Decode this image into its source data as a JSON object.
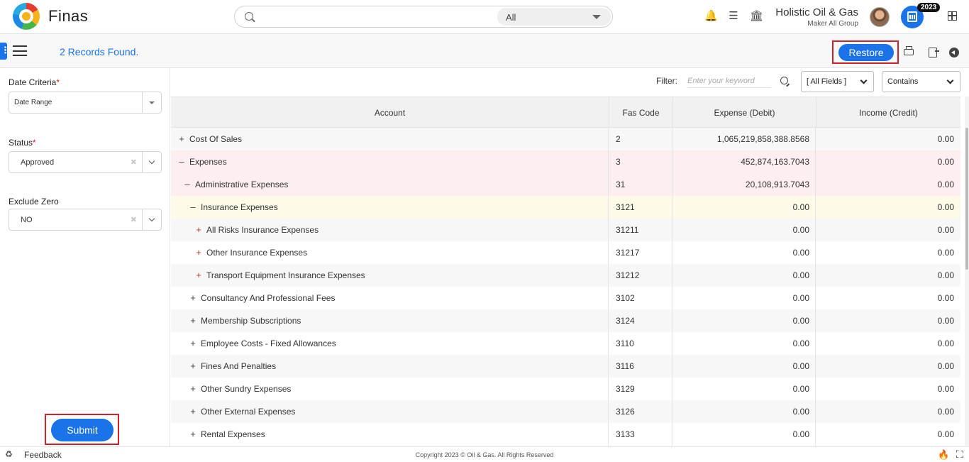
{
  "header": {
    "brand": "Finas",
    "search_placeholder": "",
    "search_scope": "All",
    "org_name": "Holistic Oil & Gas",
    "org_sub": "Maker All Group",
    "year_badge": "2023"
  },
  "toolbar": {
    "records_text": "2 Records Found.",
    "restore_label": "Restore"
  },
  "filters": {
    "date_criteria_label": "Date Criteria",
    "date_criteria_value": "Date Range",
    "status_label": "Status",
    "status_value": "Approved",
    "exclude_zero_label": "Exclude Zero",
    "exclude_zero_value": "NO",
    "submit_label": "Submit"
  },
  "filterbar": {
    "label": "Filter:",
    "placeholder": "Enter your keyword",
    "field_select": "[ All Fields ]",
    "match_select": "Contains"
  },
  "grid": {
    "columns": [
      "Account",
      "Fas Code",
      "Expense (Debit)",
      "Income (Credit)"
    ],
    "rows": [
      {
        "toggle": "+",
        "account": "Cost Of Sales",
        "fas": "2",
        "expense": "1,065,219,858,388.8568",
        "income": "0.00"
      },
      {
        "toggle": "–",
        "account": "Expenses",
        "fas": "3",
        "expense": "452,874,163.7043",
        "income": "0.00"
      },
      {
        "toggle": "–",
        "account": "Administrative Expenses",
        "fas": "31",
        "expense": "20,108,913.7043",
        "income": "0.00"
      },
      {
        "toggle": "–",
        "account": "Insurance Expenses",
        "fas": "3121",
        "expense": "0.00",
        "income": "0.00"
      },
      {
        "toggle": "+",
        "account": "All Risks Insurance Expenses",
        "fas": "31211",
        "expense": "0.00",
        "income": "0.00"
      },
      {
        "toggle": "+",
        "account": "Other Insurance Expenses",
        "fas": "31217",
        "expense": "0.00",
        "income": "0.00"
      },
      {
        "toggle": "+",
        "account": "Transport Equipment Insurance Expenses",
        "fas": "31212",
        "expense": "0.00",
        "income": "0.00"
      },
      {
        "toggle": "+",
        "account": "Consultancy And Professional Fees",
        "fas": "3102",
        "expense": "0.00",
        "income": "0.00"
      },
      {
        "toggle": "+",
        "account": "Membership Subscriptions",
        "fas": "3124",
        "expense": "0.00",
        "income": "0.00"
      },
      {
        "toggle": "+",
        "account": "Employee Costs - Fixed Allowances",
        "fas": "3110",
        "expense": "0.00",
        "income": "0.00"
      },
      {
        "toggle": "+",
        "account": "Fines And Penalties",
        "fas": "3116",
        "expense": "0.00",
        "income": "0.00"
      },
      {
        "toggle": "+",
        "account": "Other Sundry Expenses",
        "fas": "3129",
        "expense": "0.00",
        "income": "0.00"
      },
      {
        "toggle": "+",
        "account": "Other External Expenses",
        "fas": "3126",
        "expense": "0.00",
        "income": "0.00"
      },
      {
        "toggle": "+",
        "account": "Rental Expenses",
        "fas": "3133",
        "expense": "0.00",
        "income": "0.00"
      }
    ]
  },
  "footer": {
    "feedback": "Feedback",
    "copyright": "Copyright 2023 © Oil & Gas. All Rights Reserved"
  },
  "colors": {
    "accent": "#1a73e8",
    "highlight_border": "#d32029",
    "row_pink": "#fdeef0",
    "row_yellow": "#fdfbe8"
  }
}
